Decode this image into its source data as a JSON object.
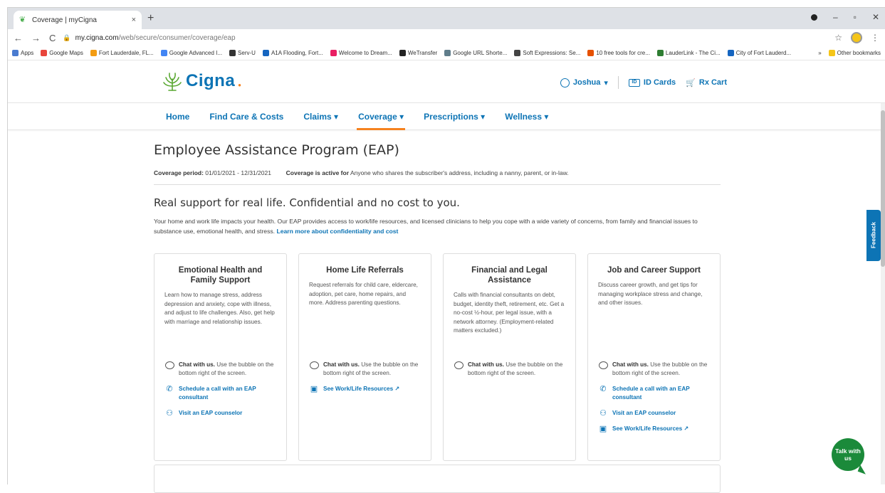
{
  "browser": {
    "tab_title": "Coverage | myCigna",
    "tab_close": "×",
    "new_tab": "+",
    "url_host": "my.cigna.com",
    "url_path": "/web/secure/consumer/coverage/eap",
    "bookmarks": [
      {
        "label": "Apps",
        "color": "#4a7bd0"
      },
      {
        "label": "Google Maps",
        "color": "#e8453c"
      },
      {
        "label": "Fort Lauderdale, FL...",
        "color": "#f39c12"
      },
      {
        "label": "Google Advanced I...",
        "color": "#4285f4"
      },
      {
        "label": "Serv-U",
        "color": "#333333"
      },
      {
        "label": "A1A Flooding, Fort...",
        "color": "#1565c0"
      },
      {
        "label": "Welcome to Dream...",
        "color": "#e91e63"
      },
      {
        "label": "WeTransfer",
        "color": "#222222"
      },
      {
        "label": "Google URL Shorte...",
        "color": "#607d8b"
      },
      {
        "label": "Soft Expressions: Se...",
        "color": "#444444"
      },
      {
        "label": "10 free tools for cre...",
        "color": "#e65100"
      },
      {
        "label": "LauderLink - The Ci...",
        "color": "#2e7d32"
      },
      {
        "label": "City of Fort Lauderd...",
        "color": "#1565c0"
      }
    ],
    "bookmarks_more": "»",
    "other_bookmarks": "Other bookmarks"
  },
  "header": {
    "logo_text": "Cigna",
    "user_name": "Joshua",
    "id_cards": "ID Cards",
    "rx_cart": "Rx Cart"
  },
  "nav": {
    "items": [
      {
        "label": "Home"
      },
      {
        "label": "Find Care & Costs"
      },
      {
        "label": "Claims ▾"
      },
      {
        "label": "Coverage ▾"
      },
      {
        "label": "Prescriptions ▾"
      },
      {
        "label": "Wellness ▾"
      }
    ],
    "active_index": 3
  },
  "page": {
    "title": "Employee Assistance Program (EAP)",
    "coverage_period_label": "Coverage period:",
    "coverage_period_value": "01/01/2021 - 12/31/2021",
    "coverage_active_label": "Coverage is active for",
    "coverage_active_value": "Anyone who shares the subscriber's address, including a nanny, parent, or in-law.",
    "subtitle": "Real support for real life. Confidential and no cost to you.",
    "intro": "Your home and work life impacts your health. Our EAP provides access to work/life resources, and licensed clinicians to help you cope with a wide variety of concerns, from family and financial issues to substance use, emotional health, and stress.",
    "intro_link": "Learn more about confidentiality and cost"
  },
  "cards": [
    {
      "title": "Emotional Health and Family Support",
      "body": "Learn how to manage stress, address depression and anxiety, cope with illness, and adjust to life challenges. Also, get help with marriage and relationship issues.",
      "chat_bold": "Chat with us.",
      "chat_text": "Use the bubble on the bottom right of the screen.",
      "schedule": "Schedule a call with an EAP consultant",
      "visit": "Visit an EAP counselor"
    },
    {
      "title": "Home Life Referrals",
      "body": "Request referrals for child care, eldercare, adoption, pet care, home repairs, and more. Address parenting questions.",
      "chat_bold": "Chat with us.",
      "chat_text": "Use the bubble on the bottom right of the screen.",
      "resources": "See Work/Life Resources ↗"
    },
    {
      "title": "Financial and Legal Assistance",
      "body": "Calls with financial consultants on debt, budget, identity theft, retirement, etc. Get a no-cost ½-hour, per legal issue, with a network attorney. (Employment-related matters excluded.)",
      "chat_bold": "Chat with us.",
      "chat_text": "Use the bubble on the bottom right of the screen."
    },
    {
      "title": "Job and Career Support",
      "body": "Discuss career growth, and get tips for managing workplace stress and change, and other issues.",
      "chat_bold": "Chat with us.",
      "chat_text": "Use the bubble on the bottom right of the screen.",
      "schedule": "Schedule a call with an EAP consultant",
      "visit": "Visit an EAP counselor",
      "resources": "See Work/Life Resources ↗"
    }
  ],
  "feedback": "Feedback",
  "talk": "Talk with us",
  "colors": {
    "brand_blue": "#0d74b5",
    "accent_orange": "#f5821f",
    "talk_green": "#1b8a3a"
  }
}
